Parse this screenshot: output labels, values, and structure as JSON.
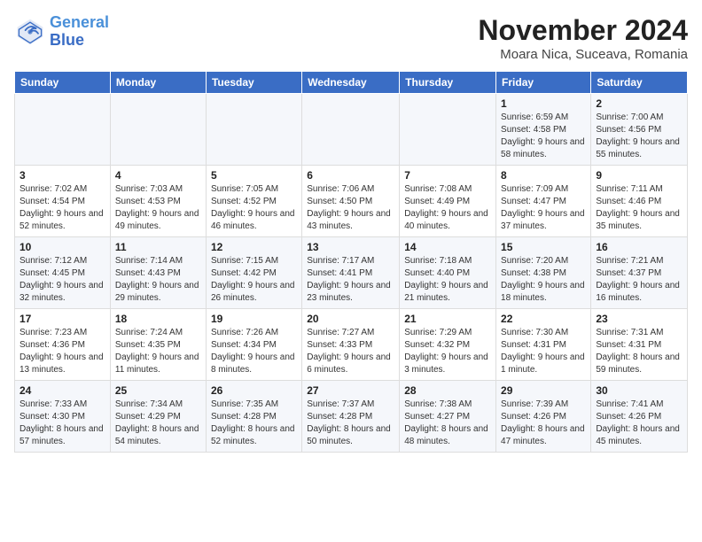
{
  "logo": {
    "line1": "General",
    "line2": "Blue"
  },
  "title": "November 2024",
  "location": "Moara Nica, Suceava, Romania",
  "days_of_week": [
    "Sunday",
    "Monday",
    "Tuesday",
    "Wednesday",
    "Thursday",
    "Friday",
    "Saturday"
  ],
  "weeks": [
    [
      {
        "day": "",
        "info": ""
      },
      {
        "day": "",
        "info": ""
      },
      {
        "day": "",
        "info": ""
      },
      {
        "day": "",
        "info": ""
      },
      {
        "day": "",
        "info": ""
      },
      {
        "day": "1",
        "info": "Sunrise: 6:59 AM\nSunset: 4:58 PM\nDaylight: 9 hours and 58 minutes."
      },
      {
        "day": "2",
        "info": "Sunrise: 7:00 AM\nSunset: 4:56 PM\nDaylight: 9 hours and 55 minutes."
      }
    ],
    [
      {
        "day": "3",
        "info": "Sunrise: 7:02 AM\nSunset: 4:54 PM\nDaylight: 9 hours and 52 minutes."
      },
      {
        "day": "4",
        "info": "Sunrise: 7:03 AM\nSunset: 4:53 PM\nDaylight: 9 hours and 49 minutes."
      },
      {
        "day": "5",
        "info": "Sunrise: 7:05 AM\nSunset: 4:52 PM\nDaylight: 9 hours and 46 minutes."
      },
      {
        "day": "6",
        "info": "Sunrise: 7:06 AM\nSunset: 4:50 PM\nDaylight: 9 hours and 43 minutes."
      },
      {
        "day": "7",
        "info": "Sunrise: 7:08 AM\nSunset: 4:49 PM\nDaylight: 9 hours and 40 minutes."
      },
      {
        "day": "8",
        "info": "Sunrise: 7:09 AM\nSunset: 4:47 PM\nDaylight: 9 hours and 37 minutes."
      },
      {
        "day": "9",
        "info": "Sunrise: 7:11 AM\nSunset: 4:46 PM\nDaylight: 9 hours and 35 minutes."
      }
    ],
    [
      {
        "day": "10",
        "info": "Sunrise: 7:12 AM\nSunset: 4:45 PM\nDaylight: 9 hours and 32 minutes."
      },
      {
        "day": "11",
        "info": "Sunrise: 7:14 AM\nSunset: 4:43 PM\nDaylight: 9 hours and 29 minutes."
      },
      {
        "day": "12",
        "info": "Sunrise: 7:15 AM\nSunset: 4:42 PM\nDaylight: 9 hours and 26 minutes."
      },
      {
        "day": "13",
        "info": "Sunrise: 7:17 AM\nSunset: 4:41 PM\nDaylight: 9 hours and 23 minutes."
      },
      {
        "day": "14",
        "info": "Sunrise: 7:18 AM\nSunset: 4:40 PM\nDaylight: 9 hours and 21 minutes."
      },
      {
        "day": "15",
        "info": "Sunrise: 7:20 AM\nSunset: 4:38 PM\nDaylight: 9 hours and 18 minutes."
      },
      {
        "day": "16",
        "info": "Sunrise: 7:21 AM\nSunset: 4:37 PM\nDaylight: 9 hours and 16 minutes."
      }
    ],
    [
      {
        "day": "17",
        "info": "Sunrise: 7:23 AM\nSunset: 4:36 PM\nDaylight: 9 hours and 13 minutes."
      },
      {
        "day": "18",
        "info": "Sunrise: 7:24 AM\nSunset: 4:35 PM\nDaylight: 9 hours and 11 minutes."
      },
      {
        "day": "19",
        "info": "Sunrise: 7:26 AM\nSunset: 4:34 PM\nDaylight: 9 hours and 8 minutes."
      },
      {
        "day": "20",
        "info": "Sunrise: 7:27 AM\nSunset: 4:33 PM\nDaylight: 9 hours and 6 minutes."
      },
      {
        "day": "21",
        "info": "Sunrise: 7:29 AM\nSunset: 4:32 PM\nDaylight: 9 hours and 3 minutes."
      },
      {
        "day": "22",
        "info": "Sunrise: 7:30 AM\nSunset: 4:31 PM\nDaylight: 9 hours and 1 minute."
      },
      {
        "day": "23",
        "info": "Sunrise: 7:31 AM\nSunset: 4:31 PM\nDaylight: 8 hours and 59 minutes."
      }
    ],
    [
      {
        "day": "24",
        "info": "Sunrise: 7:33 AM\nSunset: 4:30 PM\nDaylight: 8 hours and 57 minutes."
      },
      {
        "day": "25",
        "info": "Sunrise: 7:34 AM\nSunset: 4:29 PM\nDaylight: 8 hours and 54 minutes."
      },
      {
        "day": "26",
        "info": "Sunrise: 7:35 AM\nSunset: 4:28 PM\nDaylight: 8 hours and 52 minutes."
      },
      {
        "day": "27",
        "info": "Sunrise: 7:37 AM\nSunset: 4:28 PM\nDaylight: 8 hours and 50 minutes."
      },
      {
        "day": "28",
        "info": "Sunrise: 7:38 AM\nSunset: 4:27 PM\nDaylight: 8 hours and 48 minutes."
      },
      {
        "day": "29",
        "info": "Sunrise: 7:39 AM\nSunset: 4:26 PM\nDaylight: 8 hours and 47 minutes."
      },
      {
        "day": "30",
        "info": "Sunrise: 7:41 AM\nSunset: 4:26 PM\nDaylight: 8 hours and 45 minutes."
      }
    ]
  ]
}
